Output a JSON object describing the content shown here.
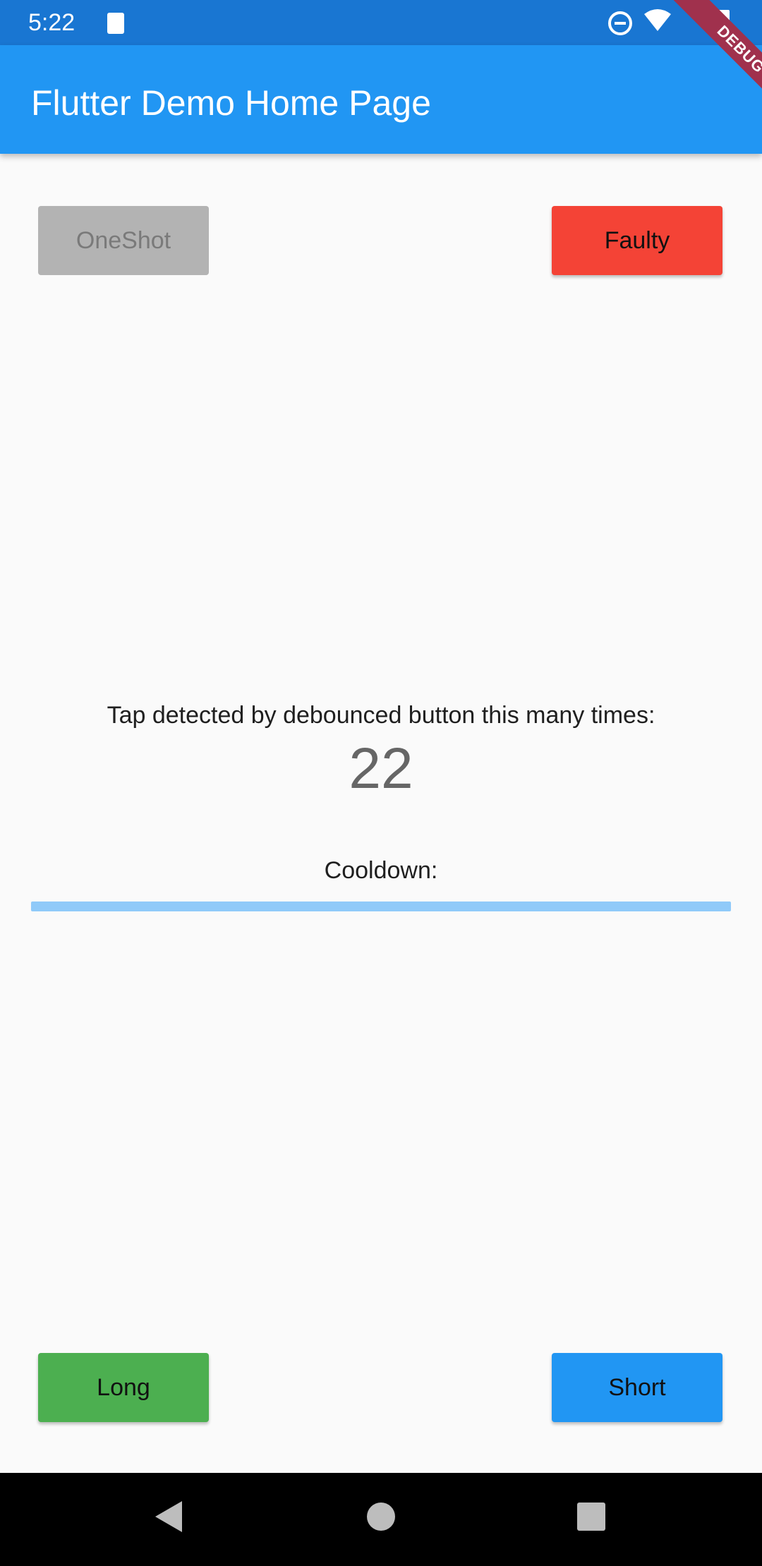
{
  "status_bar": {
    "time": "5:22",
    "icons": [
      "sd-card-icon",
      "do-not-disturb-icon",
      "wifi-icon",
      "battery-icon"
    ]
  },
  "app_bar": {
    "title": "Flutter Demo Home Page"
  },
  "debug_banner": {
    "label": "DEBUG"
  },
  "buttons": {
    "oneshot": "OneShot",
    "faulty": "Faulty",
    "long": "Long",
    "short": "Short"
  },
  "counter": {
    "label": "Tap detected by debounced button this many times:",
    "value": "22"
  },
  "cooldown": {
    "label": "Cooldown:",
    "progress": 0
  },
  "colors": {
    "primary": "#2196f3",
    "primary_dark": "#1976d2",
    "faulty": "#f44336",
    "long": "#4caf50",
    "disabled": "#b3b3b3",
    "debug_banner": "#a0314d"
  },
  "nav_bar": {
    "icons": [
      "back-icon",
      "home-icon",
      "recents-icon"
    ]
  }
}
